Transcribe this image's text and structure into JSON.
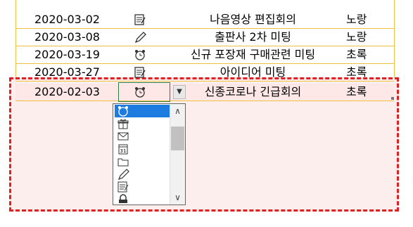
{
  "rows": [
    {
      "date": "2020-03-02",
      "icon": "memo-icon",
      "title": "나음영상 편집회의",
      "color": "노랑"
    },
    {
      "date": "2020-03-08",
      "icon": "pencil-icon",
      "title": "출판사 2차 미팅",
      "color": "노랑"
    },
    {
      "date": "2020-03-19",
      "icon": "alarm-clock-icon",
      "title": "신규 포장재 구매관련 미팅",
      "color": "초록"
    },
    {
      "date": "2020-03-27",
      "icon": "memo-icon",
      "title": "아이디어 미팅",
      "color": "초록"
    },
    {
      "date": "2020-02-03",
      "icon": "alarm-clock-icon",
      "title": "신종코로나 긴급회의",
      "color": "초록"
    }
  ],
  "dropdown": {
    "items": [
      "alarm-clock-icon",
      "gift-icon",
      "envelope-icon",
      "calendar-icon",
      "folder-icon",
      "pencil-icon",
      "memo-icon",
      "lock-icon"
    ],
    "selected_index": 0,
    "calendar_day": "31"
  },
  "colors": {
    "grid": "#f0c040",
    "selection_border": "#e02020",
    "selection_fill": "#fdeeee",
    "highlight": "#1e7be0",
    "cell_outline": "#2e7d46"
  }
}
